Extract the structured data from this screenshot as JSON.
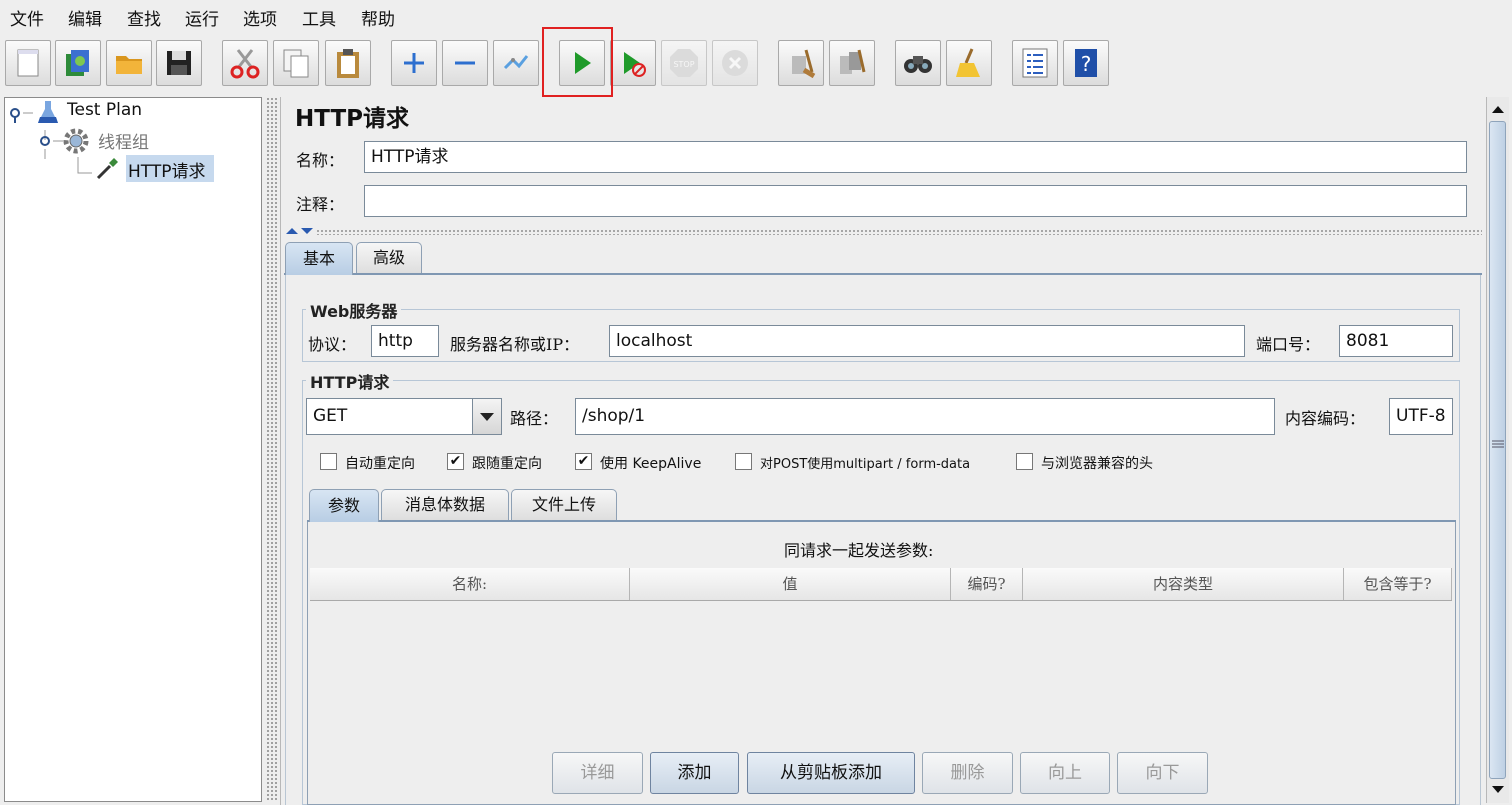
{
  "menu": [
    "文件",
    "编辑",
    "查找",
    "运行",
    "选项",
    "工具",
    "帮助"
  ],
  "toolbar": {
    "buttons": [
      {
        "icon": "new-icon"
      },
      {
        "icon": "templates-icon"
      },
      {
        "icon": "open-icon"
      },
      {
        "icon": "save-icon"
      },
      {
        "icon": "cut-icon"
      },
      {
        "icon": "copy-icon"
      },
      {
        "icon": "paste-icon"
      },
      {
        "icon": "expand-icon"
      },
      {
        "icon": "collapse-icon"
      },
      {
        "icon": "toggle-icon"
      },
      {
        "icon": "start-icon"
      },
      {
        "icon": "start-no-pauses-icon"
      },
      {
        "icon": "stop-icon"
      },
      {
        "icon": "shutdown-icon"
      },
      {
        "icon": "clear-icon"
      },
      {
        "icon": "clear-all-icon"
      },
      {
        "icon": "search-icon"
      },
      {
        "icon": "reset-search-icon"
      },
      {
        "icon": "function-helper-icon"
      },
      {
        "icon": "help-icon"
      }
    ],
    "highlight_color": "#e02020"
  },
  "tree": {
    "root": "Test Plan",
    "thread_group": "线程组",
    "sampler": "HTTP请求"
  },
  "panel": {
    "title": "HTTP请求",
    "name_label": "名称：",
    "name_value": "HTTP请求",
    "comment_label": "注释：",
    "comment_value": ""
  },
  "tabs": [
    "基本",
    "高级"
  ],
  "web_server": {
    "title": "Web服务器",
    "protocol_label": "协议：",
    "protocol_value": "http",
    "server_label": "服务器名称或IP：",
    "server_value": "localhost",
    "port_label": "端口号：",
    "port_value": "8081"
  },
  "http_request": {
    "title": "HTTP请求",
    "method": "GET",
    "path_label": "路径：",
    "path_value": "/shop/1",
    "encoding_label": "内容编码：",
    "encoding_value": "UTF-8",
    "options": [
      {
        "label": "自动重定向",
        "checked": false
      },
      {
        "label": "跟随重定向",
        "checked": true
      },
      {
        "label": "使用 KeepAlive",
        "checked": true
      },
      {
        "label": "对POST使用multipart / form-data",
        "checked": false
      },
      {
        "label": "与浏览器兼容的头",
        "checked": false
      }
    ]
  },
  "sub_tabs": [
    "参数",
    "消息体数据",
    "文件上传"
  ],
  "params": {
    "caption": "同请求一起发送参数:",
    "columns": [
      "名称:",
      "值",
      "编码?",
      "内容类型",
      "包含等于?"
    ]
  },
  "buttons": {
    "detail": "详细",
    "add": "添加",
    "add_clipboard": "从剪贴板添加",
    "delete": "删除",
    "up": "向上",
    "down": "向下"
  }
}
